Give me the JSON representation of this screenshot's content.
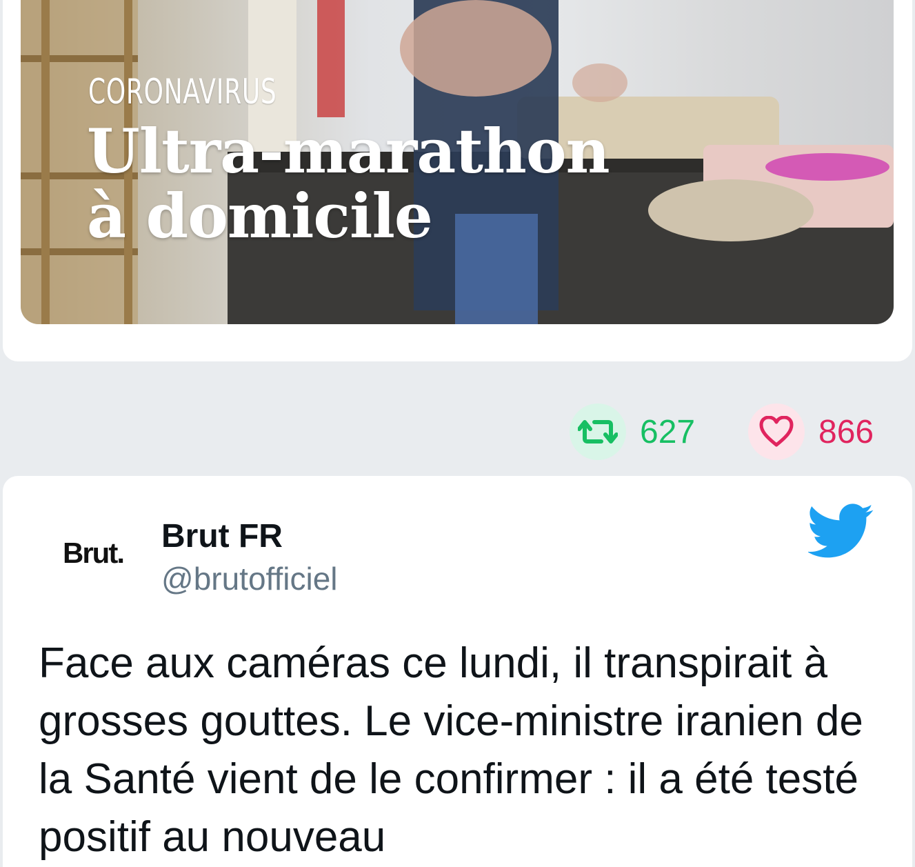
{
  "media": {
    "kicker": "CORONAVIRUS",
    "title_line1": "Ultra-marathon",
    "title_line2": "à domicile"
  },
  "actions": {
    "retweet_count": "627",
    "like_count": "866",
    "retweet_icon": "retweet-icon",
    "like_icon": "heart-icon",
    "retweet_color": "#17bf63",
    "like_color": "#e0245e"
  },
  "tweet": {
    "avatar_text": "Brut.",
    "display_name": "Brut FR",
    "handle": "@brutofficiel",
    "brand_icon": "twitter-bird-icon",
    "brand_color": "#1da1f2",
    "text": "Face aux caméras ce lundi, il transpirait à grosses gouttes. Le vice-ministre iranien de la Santé vient de le confirmer : il a été testé positif au nouveau"
  }
}
